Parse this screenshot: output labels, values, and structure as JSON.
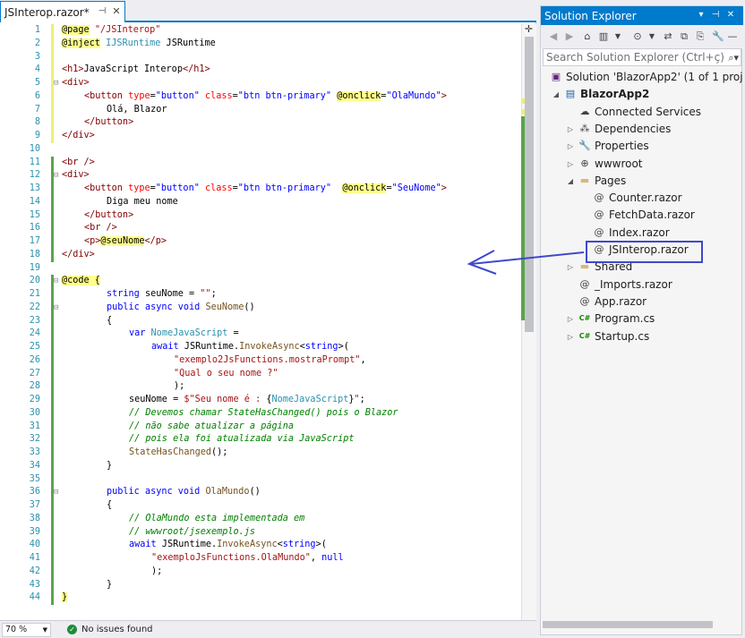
{
  "editor": {
    "tab_title": "JSInterop.razor*",
    "pin_icon": "pin-icon",
    "close_icon": "close-icon",
    "zoom": "70 %",
    "issues": "No issues found",
    "lines": [
      {
        "n": "1",
        "indent": 0,
        "parts": [
          [
            "rz",
            "@page"
          ],
          [
            "pn",
            " "
          ],
          [
            "st",
            "\"/JSInterop\""
          ]
        ]
      },
      {
        "n": "2",
        "indent": 0,
        "parts": [
          [
            "rz",
            "@inject"
          ],
          [
            "pn",
            " "
          ],
          [
            "ty",
            "IJSRuntime"
          ],
          [
            "pn",
            " JSRuntime"
          ]
        ]
      },
      {
        "n": "3",
        "indent": 0,
        "parts": []
      },
      {
        "n": "4",
        "indent": 0,
        "parts": [
          [
            "tg",
            "<h1>"
          ],
          [
            "pn",
            "JavaScript Interop"
          ],
          [
            "tg",
            "</h1>"
          ]
        ]
      },
      {
        "n": "5",
        "indent": 0,
        "parts": [
          [
            "tg",
            "<div>"
          ]
        ]
      },
      {
        "n": "6",
        "indent": 1,
        "parts": [
          [
            "tg",
            "<button "
          ],
          [
            "at",
            "type"
          ],
          [
            "pn",
            "="
          ],
          [
            "kw",
            "\"button\""
          ],
          [
            "pn",
            " "
          ],
          [
            "at",
            "class"
          ],
          [
            "pn",
            "="
          ],
          [
            "kw",
            "\"btn btn-primary\""
          ],
          [
            "pn",
            " "
          ],
          [
            "rz",
            "@onclick"
          ],
          [
            "pn",
            "="
          ],
          [
            "kw",
            "\"OlaMundo\""
          ],
          [
            "tg",
            ">"
          ]
        ]
      },
      {
        "n": "7",
        "indent": 2,
        "parts": [
          [
            "pn",
            "Olá, Blazor"
          ]
        ]
      },
      {
        "n": "8",
        "indent": 1,
        "parts": [
          [
            "tg",
            "</button>"
          ]
        ]
      },
      {
        "n": "9",
        "indent": 0,
        "parts": [
          [
            "tg",
            "</div>"
          ]
        ]
      },
      {
        "n": "10",
        "indent": 0,
        "parts": []
      },
      {
        "n": "11",
        "indent": 0,
        "parts": [
          [
            "tg",
            "<br />"
          ]
        ]
      },
      {
        "n": "12",
        "indent": 0,
        "parts": [
          [
            "tg",
            "<div>"
          ]
        ]
      },
      {
        "n": "13",
        "indent": 1,
        "parts": [
          [
            "tg",
            "<button "
          ],
          [
            "at",
            "type"
          ],
          [
            "pn",
            "="
          ],
          [
            "kw",
            "\"button\""
          ],
          [
            "pn",
            " "
          ],
          [
            "at",
            "class"
          ],
          [
            "pn",
            "="
          ],
          [
            "kw",
            "\"btn btn-primary\""
          ],
          [
            "pn",
            "  "
          ],
          [
            "rz",
            "@onclick"
          ],
          [
            "pn",
            "="
          ],
          [
            "kw",
            "\"SeuNome\""
          ],
          [
            "tg",
            ">"
          ]
        ]
      },
      {
        "n": "14",
        "indent": 2,
        "parts": [
          [
            "pn",
            "Diga meu nome"
          ]
        ]
      },
      {
        "n": "15",
        "indent": 1,
        "parts": [
          [
            "tg",
            "</button>"
          ]
        ]
      },
      {
        "n": "16",
        "indent": 1,
        "parts": [
          [
            "tg",
            "<br />"
          ]
        ]
      },
      {
        "n": "17",
        "indent": 1,
        "parts": [
          [
            "tg",
            "<p>"
          ],
          [
            "rz",
            "@seuNome"
          ],
          [
            "tg",
            "</p>"
          ]
        ]
      },
      {
        "n": "18",
        "indent": 0,
        "parts": [
          [
            "tg",
            "</div>"
          ]
        ]
      },
      {
        "n": "19",
        "indent": 0,
        "parts": []
      },
      {
        "n": "20",
        "indent": 0,
        "parts": [
          [
            "rz",
            "@code {"
          ]
        ]
      },
      {
        "n": "21",
        "indent": 2,
        "parts": [
          [
            "kw",
            "string"
          ],
          [
            "pn",
            " seuNome = "
          ],
          [
            "st",
            "\"\""
          ],
          [
            "pn",
            ";"
          ]
        ]
      },
      {
        "n": "22",
        "indent": 2,
        "parts": [
          [
            "kw",
            "public"
          ],
          [
            "pn",
            " "
          ],
          [
            "kw",
            "async"
          ],
          [
            "pn",
            " "
          ],
          [
            "kw",
            "void"
          ],
          [
            "pn",
            " "
          ],
          [
            "fn",
            "SeuNome"
          ],
          [
            "pn",
            "()"
          ]
        ]
      },
      {
        "n": "23",
        "indent": 2,
        "parts": [
          [
            "pn",
            "{"
          ]
        ]
      },
      {
        "n": "24",
        "indent": 3,
        "parts": [
          [
            "kw",
            "var"
          ],
          [
            "pn",
            " "
          ],
          [
            "ty",
            "NomeJavaScript"
          ],
          [
            "pn",
            " ="
          ]
        ]
      },
      {
        "n": "25",
        "indent": 4,
        "parts": [
          [
            "kw",
            "await"
          ],
          [
            "pn",
            " JSRuntime."
          ],
          [
            "fn",
            "InvokeAsync"
          ],
          [
            "pn",
            "<"
          ],
          [
            "kw",
            "string"
          ],
          [
            "pn",
            ">("
          ]
        ]
      },
      {
        "n": "26",
        "indent": 5,
        "parts": [
          [
            "st",
            "\"exemplo2JsFunctions.mostraPrompt\""
          ],
          [
            "pn",
            ","
          ]
        ]
      },
      {
        "n": "27",
        "indent": 5,
        "parts": [
          [
            "st",
            "\"Qual o seu nome ?\""
          ]
        ]
      },
      {
        "n": "28",
        "indent": 5,
        "parts": [
          [
            "pn",
            ");"
          ]
        ]
      },
      {
        "n": "29",
        "indent": 3,
        "parts": [
          [
            "pn",
            "seuNome = "
          ],
          [
            "st",
            "$\"Seu nome é : "
          ],
          [
            "pn",
            "{"
          ],
          [
            "ty",
            "NomeJavaScript"
          ],
          [
            "pn",
            "}"
          ],
          [
            "st",
            "\""
          ],
          [
            "pn",
            ";"
          ]
        ]
      },
      {
        "n": "30",
        "indent": 3,
        "parts": [
          [
            "cm",
            "// Devemos chamar StateHasChanged() pois o Blazor"
          ]
        ]
      },
      {
        "n": "31",
        "indent": 3,
        "parts": [
          [
            "cm",
            "// não sabe atualizar a página"
          ]
        ]
      },
      {
        "n": "32",
        "indent": 3,
        "parts": [
          [
            "cm",
            "// pois ela foi atualizada via JavaScript"
          ]
        ]
      },
      {
        "n": "33",
        "indent": 3,
        "parts": [
          [
            "fn",
            "StateHasChanged"
          ],
          [
            "pn",
            "();"
          ]
        ]
      },
      {
        "n": "34",
        "indent": 2,
        "parts": [
          [
            "pn",
            "}"
          ]
        ]
      },
      {
        "n": "35",
        "indent": 0,
        "parts": []
      },
      {
        "n": "36",
        "indent": 2,
        "parts": [
          [
            "kw",
            "public"
          ],
          [
            "pn",
            " "
          ],
          [
            "kw",
            "async"
          ],
          [
            "pn",
            " "
          ],
          [
            "kw",
            "void"
          ],
          [
            "pn",
            " "
          ],
          [
            "fn",
            "OlaMundo"
          ],
          [
            "pn",
            "()"
          ]
        ]
      },
      {
        "n": "37",
        "indent": 2,
        "parts": [
          [
            "pn",
            "{"
          ]
        ]
      },
      {
        "n": "38",
        "indent": 3,
        "parts": [
          [
            "cm",
            "// OlaMundo esta implementada em"
          ]
        ]
      },
      {
        "n": "39",
        "indent": 3,
        "parts": [
          [
            "cm",
            "// wwwroot/jsexemplo.js"
          ]
        ]
      },
      {
        "n": "40",
        "indent": 3,
        "parts": [
          [
            "kw",
            "await"
          ],
          [
            "pn",
            " JSRuntime."
          ],
          [
            "fn",
            "InvokeAsync"
          ],
          [
            "pn",
            "<"
          ],
          [
            "kw",
            "string"
          ],
          [
            "pn",
            ">("
          ]
        ]
      },
      {
        "n": "41",
        "indent": 4,
        "parts": [
          [
            "st",
            "\"exemploJsFunctions.OlaMundo\""
          ],
          [
            "pn",
            ", "
          ],
          [
            "kw",
            "null"
          ]
        ]
      },
      {
        "n": "42",
        "indent": 4,
        "parts": [
          [
            "pn",
            ");"
          ]
        ]
      },
      {
        "n": "43",
        "indent": 2,
        "parts": [
          [
            "pn",
            "}"
          ]
        ]
      },
      {
        "n": "44",
        "indent": 0,
        "parts": [
          [
            "rz",
            "}"
          ]
        ]
      }
    ]
  },
  "solution_explorer": {
    "title": "Solution Explorer",
    "search_placeholder": "Search Solution Explorer (Ctrl+ç)",
    "tree": [
      {
        "label": "Solution 'BlazorApp2' (1 of 1 proj",
        "level": 0,
        "exp": "",
        "icon": "solution-icon",
        "glyph": "▣",
        "color": "#68217a",
        "bold": false
      },
      {
        "label": "BlazorApp2",
        "level": 1,
        "exp": "◢",
        "icon": "project-icon",
        "glyph": "▤",
        "color": "#1e5fa8",
        "bold": true
      },
      {
        "label": "Connected Services",
        "level": 2,
        "exp": "",
        "icon": "connected-services-icon",
        "glyph": "☁",
        "color": "#424242",
        "bold": false
      },
      {
        "label": "Dependencies",
        "level": 2,
        "exp": "▷",
        "icon": "dependencies-icon",
        "glyph": "⁂",
        "color": "#424242",
        "bold": false
      },
      {
        "label": "Properties",
        "level": 2,
        "exp": "▷",
        "icon": "properties-icon",
        "glyph": "🔧",
        "color": "#424242",
        "bold": false
      },
      {
        "label": "wwwroot",
        "level": 2,
        "exp": "▷",
        "icon": "globe-icon",
        "glyph": "⊕",
        "color": "#424242",
        "bold": false
      },
      {
        "label": "Pages",
        "level": 2,
        "exp": "◢",
        "icon": "folder-icon",
        "glyph": "▬",
        "color": "#dcb67a",
        "bold": false
      },
      {
        "label": "Counter.razor",
        "level": 3,
        "exp": "",
        "icon": "razor-file-icon",
        "glyph": "@",
        "color": "#424242",
        "bold": false
      },
      {
        "label": "FetchData.razor",
        "level": 3,
        "exp": "",
        "icon": "razor-file-icon",
        "glyph": "@",
        "color": "#424242",
        "bold": false
      },
      {
        "label": "Index.razor",
        "level": 3,
        "exp": "",
        "icon": "razor-file-icon",
        "glyph": "@",
        "color": "#424242",
        "bold": false
      },
      {
        "label": "JSInterop.razor",
        "level": 3,
        "exp": "",
        "icon": "razor-file-icon",
        "glyph": "@",
        "color": "#424242",
        "bold": false,
        "selected": true
      },
      {
        "label": "Shared",
        "level": 2,
        "exp": "▷",
        "icon": "folder-icon",
        "glyph": "▬",
        "color": "#dcb67a",
        "bold": false
      },
      {
        "label": "_Imports.razor",
        "level": 2,
        "exp": "",
        "icon": "razor-file-icon",
        "glyph": "@",
        "color": "#424242",
        "bold": false
      },
      {
        "label": "App.razor",
        "level": 2,
        "exp": "",
        "icon": "razor-file-icon",
        "glyph": "@",
        "color": "#424242",
        "bold": false
      },
      {
        "label": "Program.cs",
        "level": 2,
        "exp": "▷",
        "icon": "csharp-file-icon",
        "glyph": "C#",
        "color": "#178600",
        "bold": false
      },
      {
        "label": "Startup.cs",
        "level": 2,
        "exp": "▷",
        "icon": "csharp-file-icon",
        "glyph": "C#",
        "color": "#178600",
        "bold": false
      }
    ]
  },
  "colors": {
    "accent": "#007acc",
    "annotation": "#3f48cc"
  }
}
